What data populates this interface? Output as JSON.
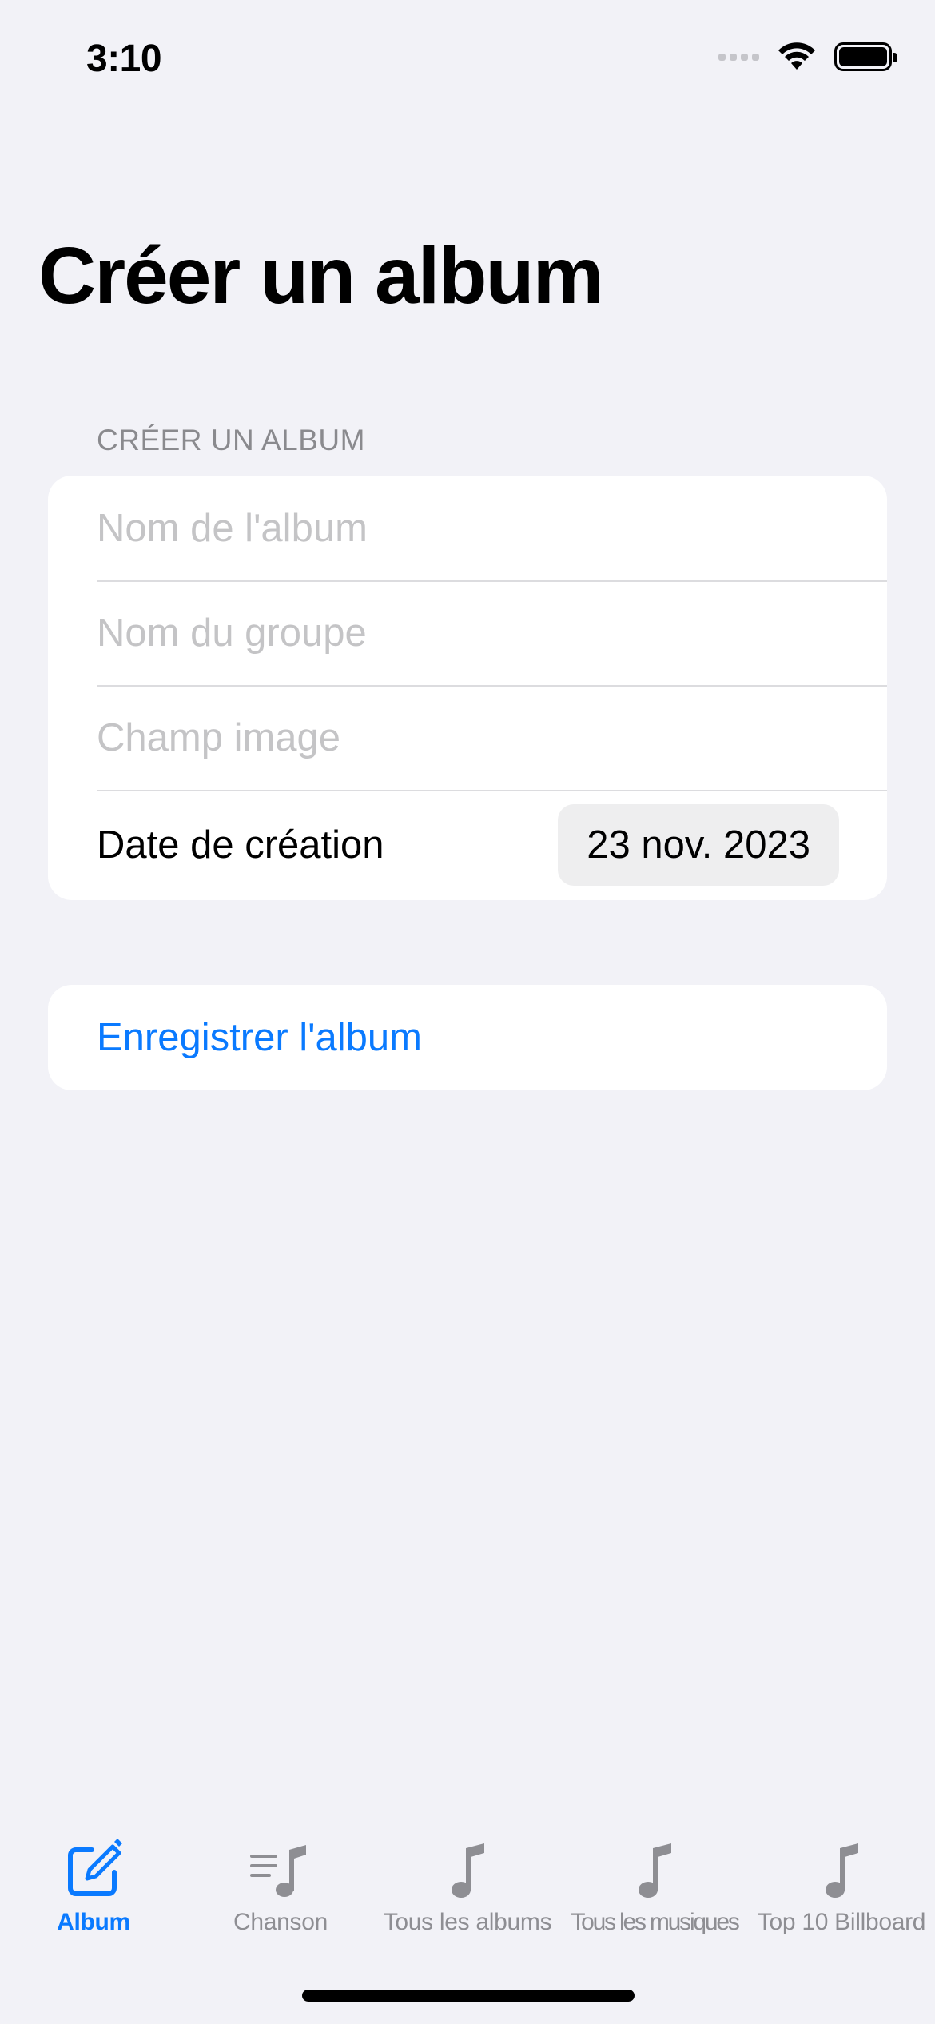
{
  "status_bar": {
    "time": "3:10"
  },
  "page": {
    "title": "Créer un album"
  },
  "form": {
    "section_header": "CRÉER UN ALBUM",
    "album_name": {
      "placeholder": "Nom de l'album",
      "value": ""
    },
    "group_name": {
      "placeholder": "Nom du groupe",
      "value": ""
    },
    "image_field": {
      "placeholder": "Champ image",
      "value": ""
    },
    "date_label": "Date de création",
    "date_value": "23 nov. 2023"
  },
  "actions": {
    "save_label": "Enregistrer l'album"
  },
  "tabbar": {
    "accent_color": "#0A7AFF",
    "inactive_color": "#8E8E93",
    "items": [
      {
        "label": "Album",
        "icon": "square-and-pencil-icon",
        "active": true
      },
      {
        "label": "Chanson",
        "icon": "music-note-list-icon",
        "active": false
      },
      {
        "label": "Tous les albums",
        "icon": "music-note-icon",
        "active": false
      },
      {
        "label": "Tous les musiques",
        "icon": "music-note-icon",
        "active": false
      },
      {
        "label": "Top 10 Billboard",
        "icon": "music-note-icon",
        "active": false
      }
    ]
  }
}
